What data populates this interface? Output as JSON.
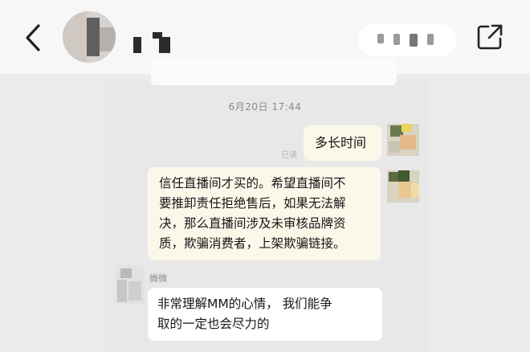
{
  "header": {
    "back_icon": "chevron-left-icon",
    "share_icon": "external-link-icon"
  },
  "chat": {
    "timestamp": "6月20日 17:44",
    "read_label": "已读",
    "messages": [
      {
        "from": "me",
        "text": "多长时间"
      },
      {
        "from": "me",
        "lines": [
          "信任直播间才买的。希望直播间不",
          "要推卸责任拒绝售后，如果无法解",
          "决，那么直播间涉及未审核品牌资",
          "质，欺骗消费者，上架欺骗链接。"
        ]
      },
      {
        "from": "agent",
        "sender": "微微",
        "lines": [
          "非常理解MM的心情， 我们能争",
          "取的一定也会尽力的"
        ]
      }
    ]
  },
  "colors": {
    "sent_bubble": "#fbf8ea",
    "received_bubble": "#ffffff",
    "background": "#ececec"
  }
}
